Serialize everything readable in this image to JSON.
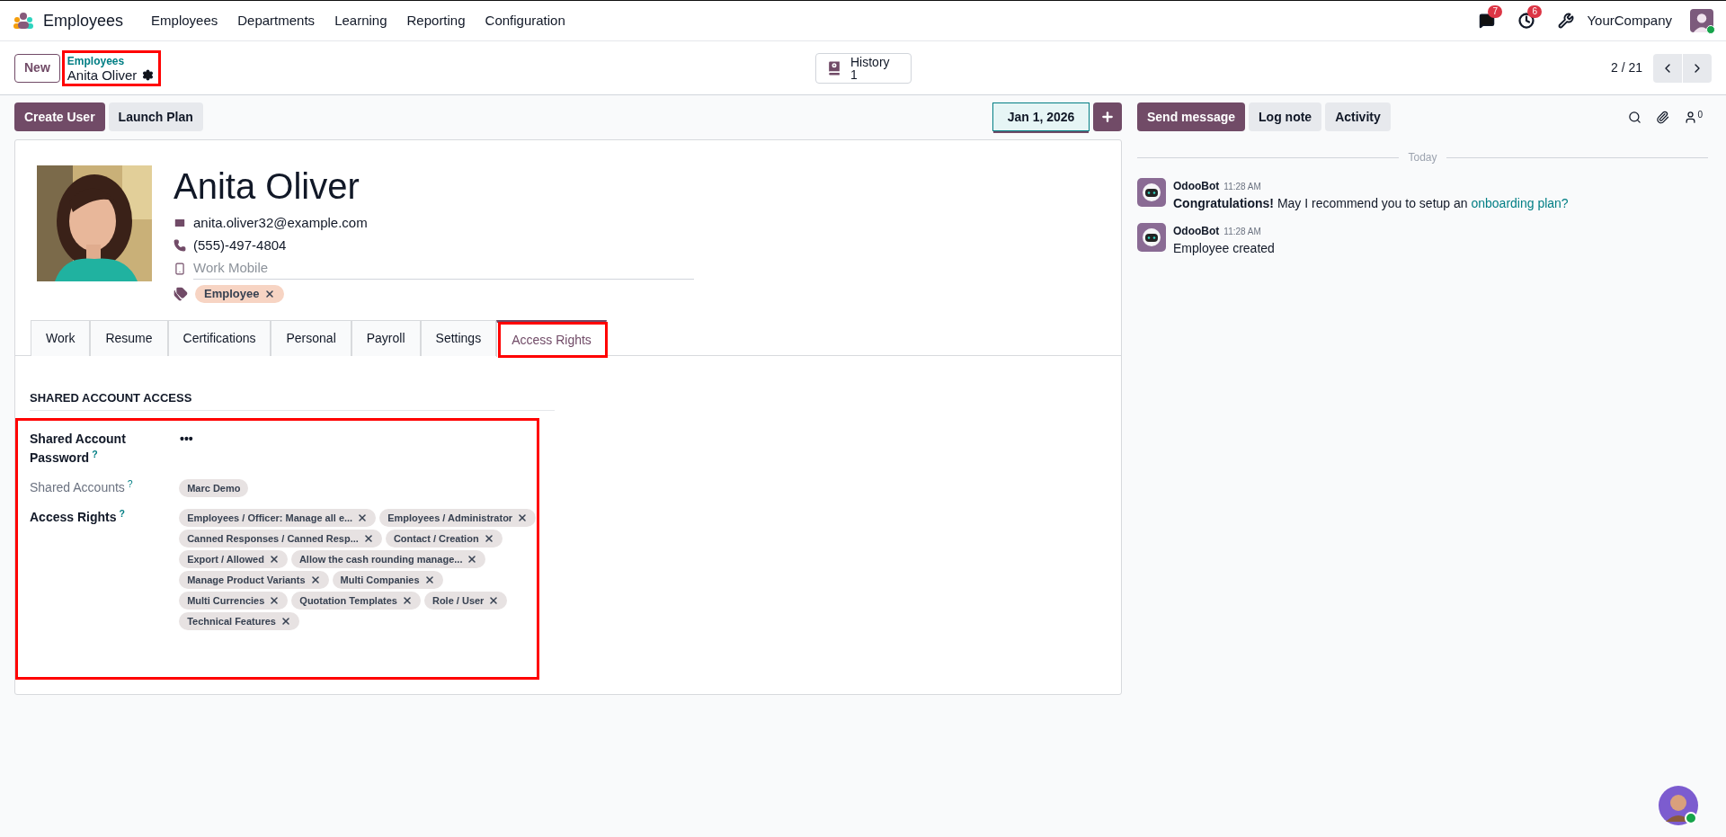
{
  "navbar": {
    "app_name": "Employees",
    "menu": [
      "Employees",
      "Departments",
      "Learning",
      "Reporting",
      "Configuration"
    ],
    "messages_badge": "7",
    "activities_badge": "6",
    "company": "YourCompany"
  },
  "control_panel": {
    "new_button": "New",
    "breadcrumb_parent": "Employees",
    "breadcrumb_current": "Anita Oliver",
    "history_label": "History",
    "history_count": "1",
    "pager": "2 / 21"
  },
  "form_buttons": [
    "Create User",
    "Launch Plan"
  ],
  "date_button": "Jan 1, 2026",
  "employee": {
    "name": "Anita Oliver",
    "email": "anita.oliver32@example.com",
    "phone": "(555)-497-4804",
    "work_mobile_placeholder": "Work Mobile",
    "tags": [
      "Employee"
    ]
  },
  "tabs": [
    {
      "label": "Work",
      "selected": false
    },
    {
      "label": "Resume",
      "selected": false
    },
    {
      "label": "Certifications",
      "selected": false
    },
    {
      "label": "Personal",
      "selected": false
    },
    {
      "label": "Payroll",
      "selected": false
    },
    {
      "label": "Settings",
      "selected": false
    },
    {
      "label": "Access Rights",
      "selected": true
    }
  ],
  "section": {
    "title": "SHARED ACCOUNT ACCESS",
    "fields": [
      {
        "label": "Shared Account Password",
        "help": "?",
        "kind": "password",
        "value": "•••",
        "muted": false
      },
      {
        "label": "Shared Accounts",
        "help": "?",
        "kind": "tags",
        "tags": [
          "Marc Demo"
        ],
        "removable": false,
        "muted": true
      },
      {
        "label": "Access Rights",
        "help": "?",
        "kind": "tags",
        "removable": true,
        "muted": false,
        "tags": [
          "Employees / Officer: Manage all e...",
          "Employees / Administrator",
          "Canned Responses / Canned Resp...",
          "Contact / Creation",
          "Export / Allowed",
          "Allow the cash rounding manage...",
          "Manage Product Variants",
          "Multi Companies",
          "Multi Currencies",
          "Quotation Templates",
          "Role / User",
          "Technical Features"
        ]
      }
    ]
  },
  "chatter": {
    "buttons": [
      {
        "label": "Send message",
        "selected": true
      },
      {
        "label": "Log note",
        "selected": false
      },
      {
        "label": "Activity",
        "selected": false
      }
    ],
    "followers_count": "0",
    "date_separator": "Today",
    "messages": [
      {
        "author": "OdooBot",
        "time": "11:28 AM",
        "text": "**Congratulations!** May I recommend you to setup an",
        "link": "onboarding plan?"
      },
      {
        "author": "OdooBot",
        "time": "11:28 AM",
        "text": "Employee created"
      }
    ]
  }
}
